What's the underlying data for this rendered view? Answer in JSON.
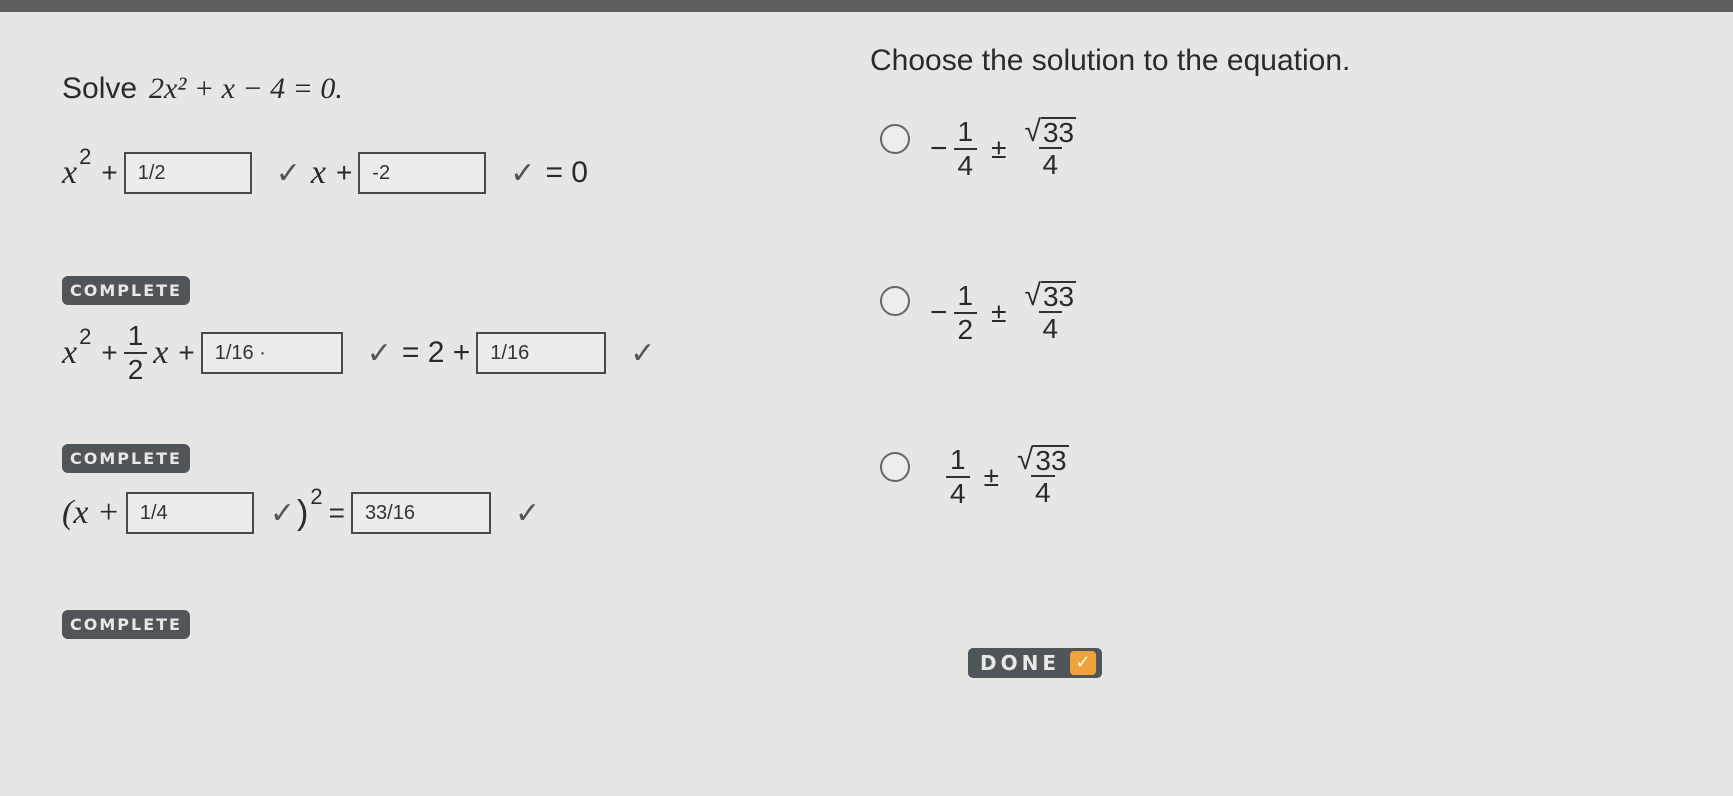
{
  "prompt_left": {
    "label": "Solve",
    "equation": "2x² + x − 4 = 0."
  },
  "prompt_right": "Choose the solution to the equation.",
  "step1": {
    "x_term": "x",
    "exp": "2",
    "plus1": "+",
    "box1": "1/2",
    "x2": "x",
    "plus2": "+",
    "box2": "-2",
    "eq": "= 0",
    "check": "✓"
  },
  "step2": {
    "badge": "COMPLETE",
    "x_term": "x",
    "exp": "2",
    "plus1": "+",
    "frac_num": "1",
    "frac_den": "2",
    "x2": "x",
    "plus2": "+",
    "box1": "1/16 ·",
    "eq": "= 2 +",
    "box2": "1/16",
    "check": "✓"
  },
  "step3": {
    "badge": "COMPLETE",
    "open": "(x +",
    "box1": "1/4",
    "close": ")",
    "exp": "2",
    "eq": "=",
    "box2": "33/16",
    "check": "✓"
  },
  "step4": {
    "badge": "COMPLETE"
  },
  "choices": [
    {
      "sign": "−",
      "num": "1",
      "den": "4",
      "pm": "±",
      "root": "√",
      "rad": "33",
      "den2": "4"
    },
    {
      "sign": "−",
      "num": "1",
      "den": "2",
      "pm": "±",
      "root": "√",
      "rad": "33",
      "den2": "4"
    },
    {
      "sign": "",
      "num": "1",
      "den": "4",
      "pm": "±",
      "root": "√",
      "rad": "33",
      "den2": "4"
    }
  ],
  "done_button": {
    "label": "DONE",
    "icon": "check-icon"
  },
  "colors": {
    "background": "#e6e6e4",
    "badge": "#4f5558",
    "done_check": "#f0a33a"
  }
}
